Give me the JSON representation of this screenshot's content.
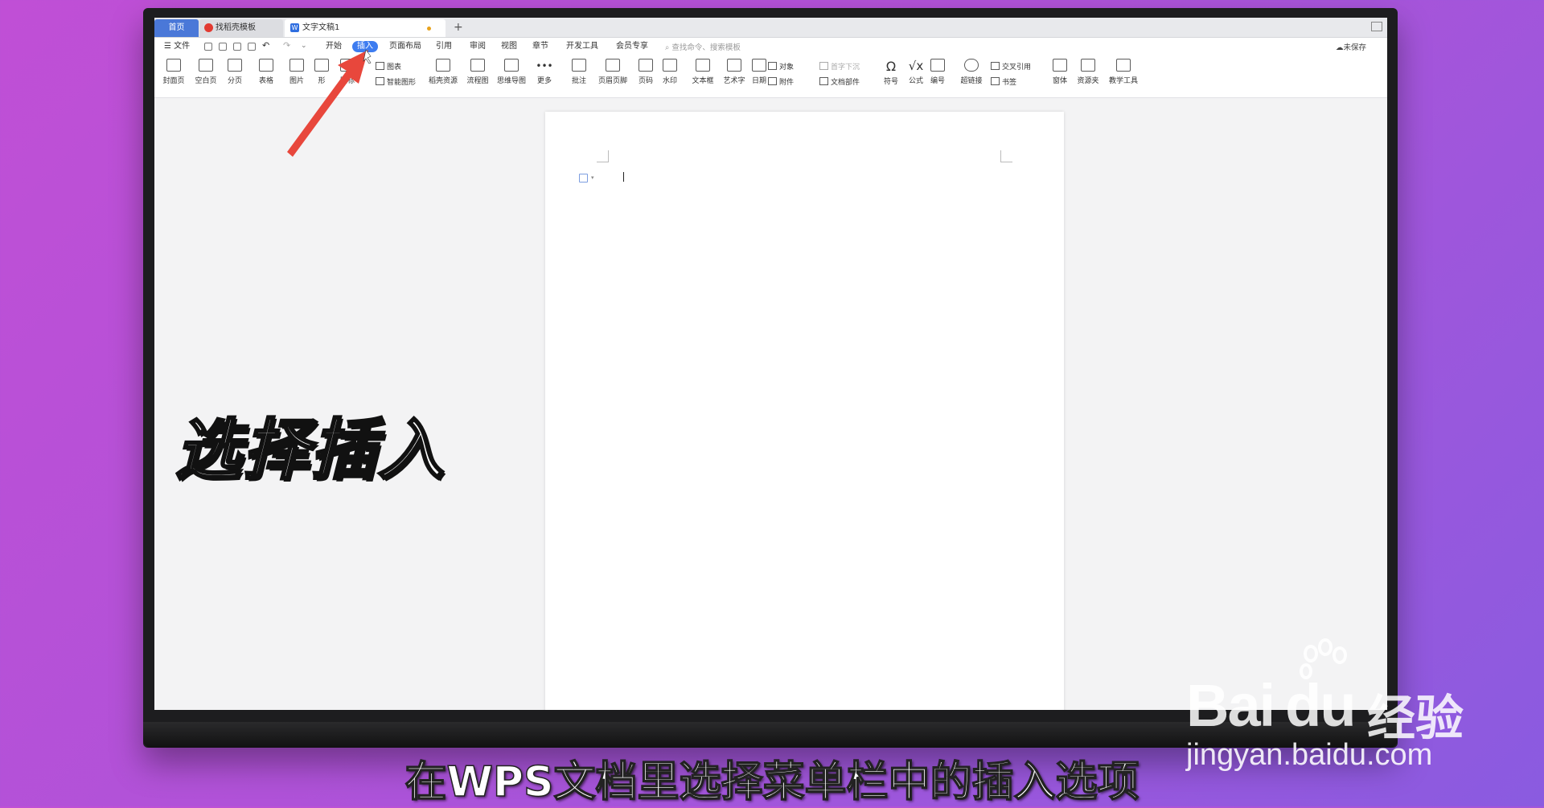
{
  "tabs": {
    "home": "首页",
    "template": "找稻壳模板",
    "document": "文字文稿1",
    "add": "+"
  },
  "menu": {
    "file": "文件",
    "items": [
      "开始",
      "插入",
      "页面布局",
      "引用",
      "审阅",
      "视图",
      "章节",
      "开发工具",
      "会员专享"
    ],
    "active": "插入",
    "search_placeholder": "查找命令、搜索模板",
    "unsaved": "未保存"
  },
  "ribbon": {
    "buttons": [
      "封面页",
      "空白页",
      "分页",
      "表格",
      "图片",
      "形",
      "图标",
      "稻壳资源",
      "流程图",
      "思维导图",
      "更多",
      "批注",
      "页眉页脚",
      "页码",
      "水印",
      "文本框",
      "艺术字",
      "日期",
      "符号",
      "公式",
      "编号",
      "超链接",
      "窗体",
      "资源夹",
      "教学工具"
    ],
    "chart": "图表",
    "smart_shape": "智能图形",
    "object": "对象",
    "attachment": "附件",
    "drop_cap": "首字下沉",
    "doc_parts": "文档部件",
    "cross_ref": "交叉引用",
    "bookmark": "书签"
  },
  "overlay": {
    "label": "选择插入",
    "subtitle": "在WPS文档里选择菜单栏中的插入选项"
  },
  "watermark": {
    "brand": "Bai",
    "brand2": "du",
    "cn": "经验",
    "url": "jingyan.baidu.com"
  },
  "colors": {
    "accent": "#3d7cf0",
    "arrow": "#e8473c",
    "background": "#b052d8"
  }
}
